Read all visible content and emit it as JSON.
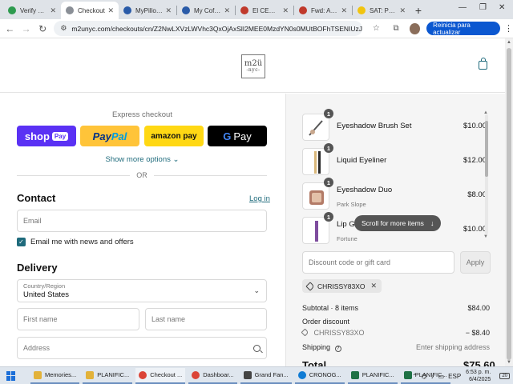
{
  "browser": {
    "tabs": [
      {
        "label": "Verify Code",
        "active": false,
        "color": "#2e9b4f"
      },
      {
        "label": "Checkout",
        "active": true,
        "color": "#8a8f96"
      },
      {
        "label": "MyPillow |",
        "active": false,
        "color": "#2a5ba8"
      },
      {
        "label": "My Coffee",
        "active": false,
        "color": "#2a5ba8"
      },
      {
        "label": "El CEO Sr",
        "active": false,
        "color": "#c0392b"
      },
      {
        "label": "Fwd: ASIG",
        "active": false,
        "color": "#c0392b"
      },
      {
        "label": "SAT: Princ",
        "active": false,
        "color": "#f1c40f"
      }
    ],
    "url": "m2unyc.com/checkouts/cn/Z2NwLXVzLWVhc3QxOjAxSlI2MEE0MzdYN0s0MUtBOFhTSENIUzJL?auto_redirect...",
    "update_button": "Reinicia para actualizar"
  },
  "store": {
    "logo_line1": "m2ü",
    "logo_line2": "-nyc-"
  },
  "checkout": {
    "express_title": "Express checkout",
    "shop_pay": "shop",
    "shop_pay_badge": "Pay",
    "paypal_a": "Pay",
    "paypal_b": "Pal",
    "amazon_pay": "amazon pay",
    "google_pay": "Pay",
    "show_more": "Show more options",
    "or": "OR",
    "contact_heading": "Contact",
    "login": "Log in",
    "email_placeholder": "Email",
    "news_label": "Email me with news and offers",
    "delivery_heading": "Delivery",
    "country_label": "Country/Region",
    "country_value": "United States",
    "first_name": "First name",
    "last_name": "Last name",
    "address": "Address"
  },
  "order": {
    "items": [
      {
        "name": "Eyeshadow Brush Set",
        "variant": "",
        "qty": "1",
        "price": "$10.00"
      },
      {
        "name": "Liquid Eyeliner",
        "variant": "",
        "qty": "1",
        "price": "$12.00"
      },
      {
        "name": "Eyeshadow Duo",
        "variant": "Park Slope",
        "qty": "1",
        "price": "$8.00"
      },
      {
        "name": "Lip Gloss",
        "variant": "Fortune",
        "qty": "1",
        "price": "$10.00"
      }
    ],
    "scroll_hint": "Scroll for more items",
    "discount_placeholder": "Discount code or gift card",
    "apply": "Apply",
    "applied_code": "CHRISSY83XO",
    "subtotal_label": "Subtotal · 8 items",
    "subtotal_value": "$84.00",
    "order_discount_label": "Order discount",
    "discount_code": "CHRISSY83XO",
    "discount_value": "− $8.40",
    "shipping_label": "Shipping",
    "shipping_value": "Enter shipping address",
    "total_label": "Total",
    "total_value": "$75.60"
  },
  "taskbar": {
    "apps": [
      {
        "label": "Memories...",
        "color": "#e2b23a"
      },
      {
        "label": "PLANIFIC...",
        "color": "#e2b23a"
      },
      {
        "label": "Checkout ...",
        "color": "#db4437"
      },
      {
        "label": "Dashboar...",
        "color": "#db4437"
      },
      {
        "label": "Grand Fan...",
        "color": "#444444"
      },
      {
        "label": "CRONOG...",
        "color": "#0f7bd4"
      },
      {
        "label": "PLANIFIC...",
        "color": "#1e7145"
      },
      {
        "label": "PLANIFIC...",
        "color": "#1e7145"
      }
    ],
    "lang": "ESP",
    "time": "6:53 p. m.",
    "date": "6/4/2025",
    "notif": "20"
  }
}
